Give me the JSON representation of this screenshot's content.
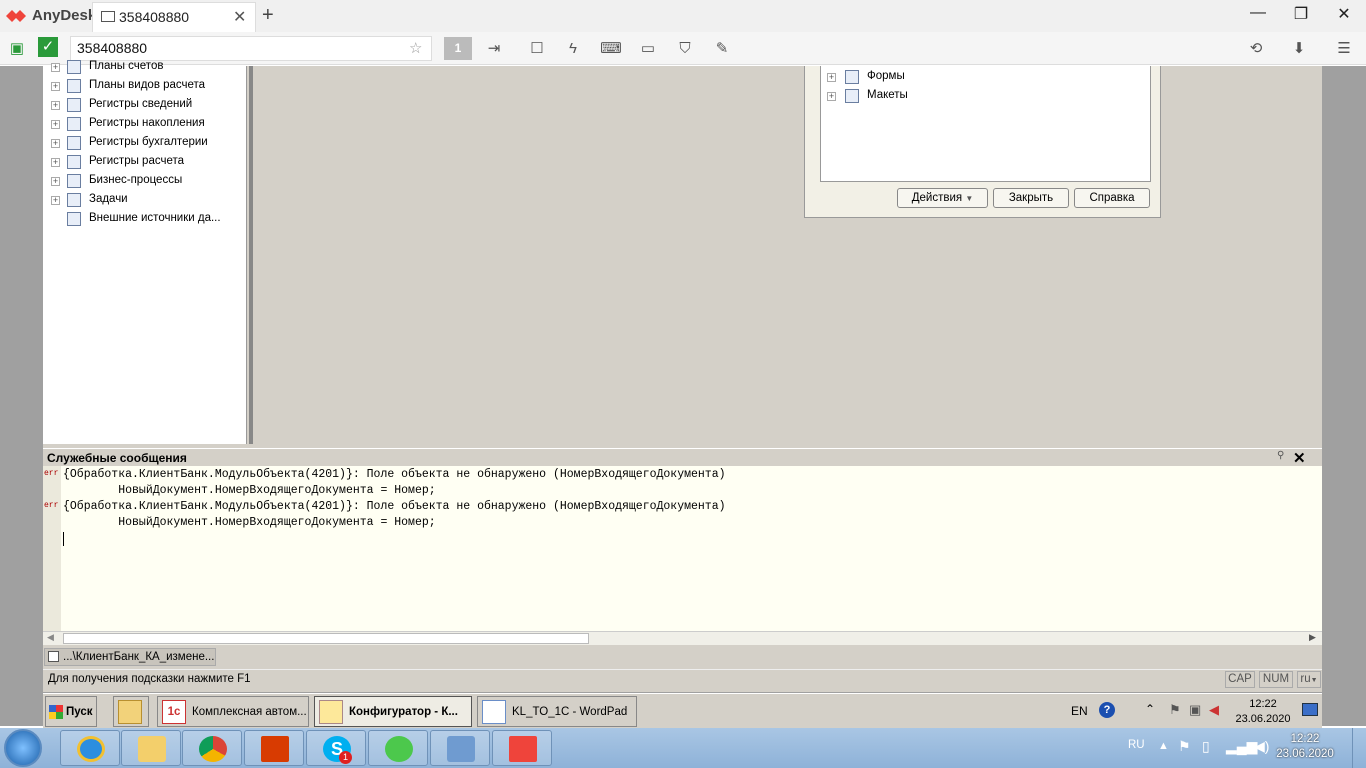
{
  "anydesk": {
    "app_name": "AnyDesk",
    "tab_label": "358408880",
    "address_value": "358408880",
    "page_indicator": "1",
    "icons": [
      "anydesk-logo-icon",
      "monitor-icon",
      "plus-icon",
      "minimize-icon",
      "maximize-icon",
      "close-icon",
      "status-green-icon",
      "verified-icon",
      "transfer-icon",
      "chat-icon",
      "lightning-icon",
      "keyboard-icon",
      "display-icon",
      "shield-icon",
      "pen-icon",
      "history-icon",
      "download-icon",
      "menu-icon"
    ]
  },
  "tree": {
    "items": [
      {
        "label": "Планы счетов"
      },
      {
        "label": "Планы видов расчета"
      },
      {
        "label": "Регистры сведений"
      },
      {
        "label": "Регистры накопления"
      },
      {
        "label": "Регистры бухгалтерии"
      },
      {
        "label": "Регистры расчета"
      },
      {
        "label": "Бизнес-процессы"
      },
      {
        "label": "Задачи"
      },
      {
        "label": "Внешние источники да..."
      }
    ]
  },
  "dialog": {
    "tree_items": [
      {
        "label": "Формы"
      },
      {
        "label": "Макеты"
      }
    ],
    "actions_label": "Действия",
    "close_label": "Закрыть",
    "help_label": "Справка"
  },
  "messages": {
    "title": "Служебные сообщения",
    "err_tag": "err",
    "lines": [
      "{Обработка.КлиентБанк.МодульОбъекта(4201)}: Поле объекта не обнаружено (НомерВходящегоДокумента)",
      "        НовыйДокумент.НомерВходящегоДокумента = Номер;",
      "{Обработка.КлиентБанк.МодульОбъекта(4201)}: Поле объекта не обнаружено (НомерВходящегоДокумента)",
      "        НовыйДокумент.НомерВходящегоДокумента = Номер;"
    ]
  },
  "window_tab": "...\\КлиентБанк_КА_измене...",
  "status": {
    "hint": "Для получения подсказки нажмите F1",
    "cap": "CAP",
    "num": "NUM",
    "lang": "ru"
  },
  "remote_taskbar": {
    "start": "Пуск",
    "buttons": [
      {
        "label": "Комплексная автом..."
      },
      {
        "label": "Конфигуратор - К..."
      },
      {
        "label": "KL_TO_1C - WordPad"
      }
    ],
    "lang": "EN",
    "time": "12:22",
    "date": "23.06.2020"
  },
  "local_taskbar": {
    "apps": [
      "ie-icon",
      "explorer-icon",
      "chrome-icon",
      "office-icon",
      "skype-icon",
      "whatsapp-icon",
      "network-icon",
      "anydesk-icon"
    ],
    "skype_badge": "1",
    "lang": "RU",
    "time": "12:22",
    "date": "23.06.2020"
  }
}
